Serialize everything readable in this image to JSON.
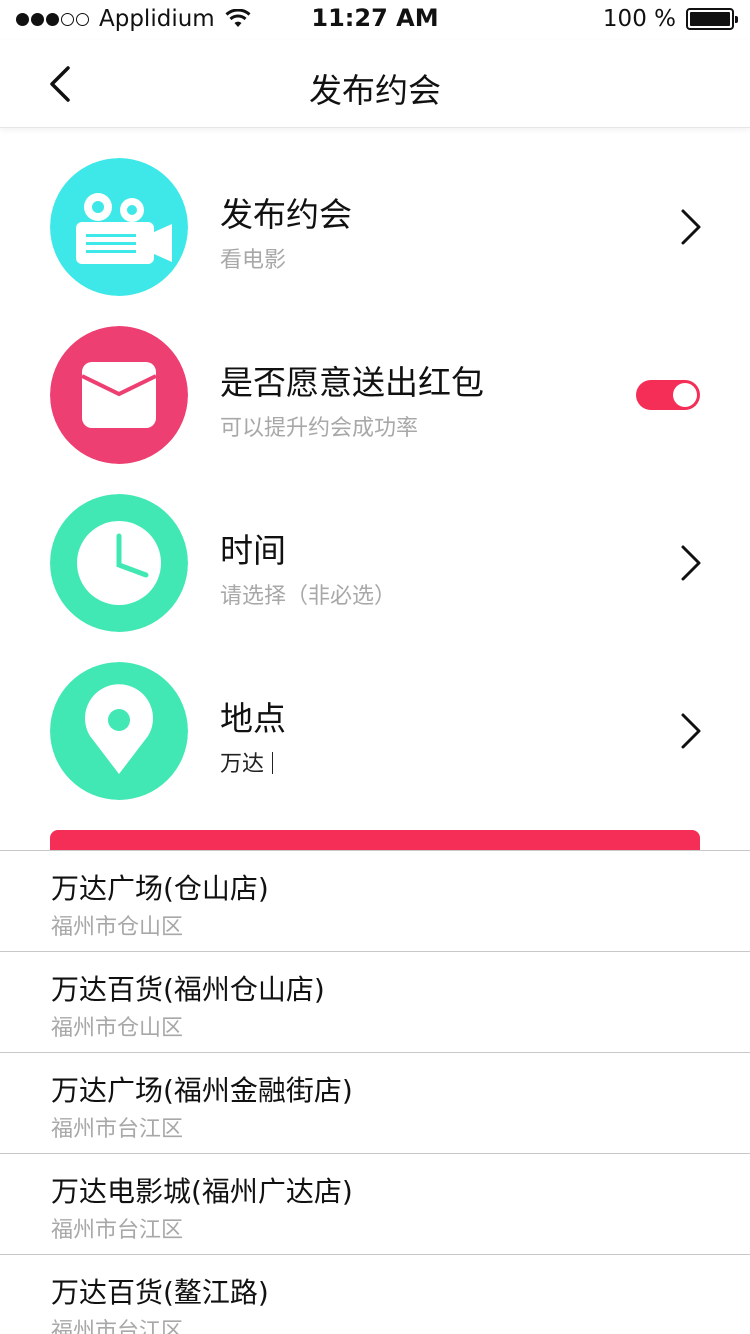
{
  "status_bar": {
    "carrier": "Applidium",
    "time": "11:27 AM",
    "battery": "100 %"
  },
  "nav": {
    "title": "发布约会",
    "back_icon": "chevron-left-icon"
  },
  "rows": [
    {
      "title": "发布约会",
      "subtitle": "看电影",
      "icon": "movie-camera-icon",
      "color": "#3ee8e8",
      "accessory": "chevron"
    },
    {
      "title": "是否愿意送出红包",
      "subtitle": "可以提升约会成功率",
      "icon": "envelope-icon",
      "color": "#ee3f72",
      "accessory": "toggle",
      "toggle_on": true
    },
    {
      "title": "时间",
      "subtitle": "请选择（非必选）",
      "icon": "clock-icon",
      "color": "#42e8b4",
      "accessory": "chevron"
    },
    {
      "title": "地点",
      "subtitle": "万达",
      "icon": "location-pin-icon",
      "color": "#42e8b4",
      "accessory": "chevron"
    }
  ],
  "accent_color": "#f52e57",
  "suggestions": [
    {
      "name": "万达广场(仓山店)",
      "area": "福州市仓山区"
    },
    {
      "name": "万达百货(福州仓山店)",
      "area": "福州市仓山区"
    },
    {
      "name": "万达广场(福州金融街店)",
      "area": "福州市台江区"
    },
    {
      "name": "万达电影城(福州广达店)",
      "area": "福州市台江区"
    },
    {
      "name": "万达百货(鳌江路)",
      "area": "福州市台江区"
    }
  ]
}
